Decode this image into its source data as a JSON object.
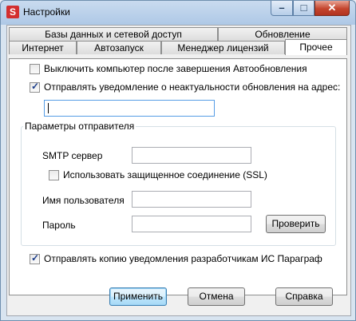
{
  "window": {
    "title": "Настройки"
  },
  "tabs": {
    "row_back": [
      "Базы данных и сетевой доступ",
      "Обновление"
    ],
    "row_front": [
      "Интернет",
      "Автозапуск",
      "Менеджер лицензий",
      "Прочее"
    ],
    "active": "Прочее"
  },
  "options": {
    "shutdown_after_update": {
      "label": "Выключить компьютер после завершения Автообновления",
      "checked": false
    },
    "send_notification": {
      "label": "Отправлять уведомление о неактуальности обновления на адрес:",
      "checked": true
    },
    "email_value": "",
    "send_copy_to_devs": {
      "label": "Отправлять копию уведомления разработчикам ИС Параграф",
      "checked": true
    }
  },
  "sender": {
    "group_title": "Параметры отправителя",
    "smtp_label": "SMTP сервер",
    "smtp_value": "",
    "ssl": {
      "label": "Использовать защищенное соединение (SSL)",
      "checked": false
    },
    "username_label": "Имя пользователя",
    "username_value": "",
    "password_label": "Пароль",
    "password_value": "",
    "check_button": "Проверить"
  },
  "buttons": {
    "apply": "Применить",
    "cancel": "Отмена",
    "help": "Справка"
  }
}
